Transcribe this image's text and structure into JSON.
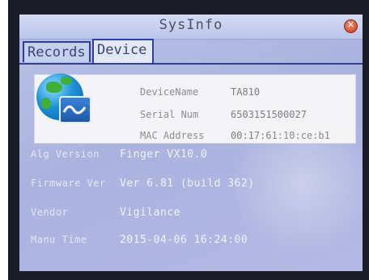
{
  "window": {
    "title": "SysInfo",
    "close_symbol": "×"
  },
  "tabs": [
    {
      "label": "Records",
      "active": false
    },
    {
      "label": "Device",
      "active": true
    }
  ],
  "device": {
    "icon": "globe-network-icon",
    "rows": [
      {
        "label": "DeviceName",
        "value": "TA810"
      },
      {
        "label": "Serial Num",
        "value": "6503151500027"
      },
      {
        "label": "MAC Address",
        "value": "00:17:61:10:ce:b1"
      }
    ]
  },
  "fields": [
    {
      "label": "Alg Version",
      "value": "Finger VX10.0"
    },
    {
      "label": "Firmware Ver",
      "value": "Ver 6.81 (build 362)"
    },
    {
      "label": "Vendor",
      "value": "Vigilance"
    },
    {
      "label": "Manu Time",
      "value": "2015-04-06 16:24:00"
    }
  ],
  "colors": {
    "tab_border": "#2f3f9a",
    "close_button": "#c23e24"
  }
}
